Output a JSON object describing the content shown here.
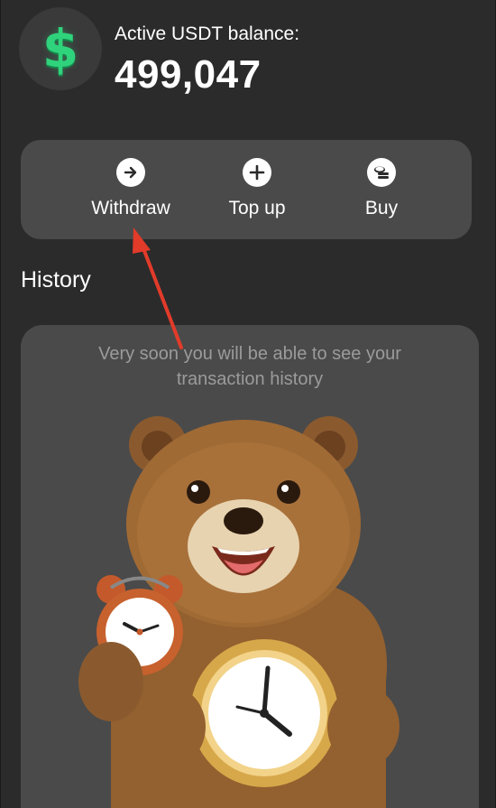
{
  "balance": {
    "label": "Active USDT balance:",
    "value": "499,047",
    "icon": "dollar-coin-icon",
    "accent_color": "#2fd37b"
  },
  "actions": [
    {
      "label": "Withdraw",
      "icon": "arrow-right-circle-icon"
    },
    {
      "label": "Top up",
      "icon": "plus-circle-icon"
    },
    {
      "label": "Buy",
      "icon": "coins-icon"
    }
  ],
  "history": {
    "title": "History",
    "empty_message": "Very soon you will be able to see your transaction history",
    "illustration": "bear-with-clocks-illustration"
  },
  "annotation": {
    "color": "#e23b2a",
    "target": "Withdraw"
  }
}
